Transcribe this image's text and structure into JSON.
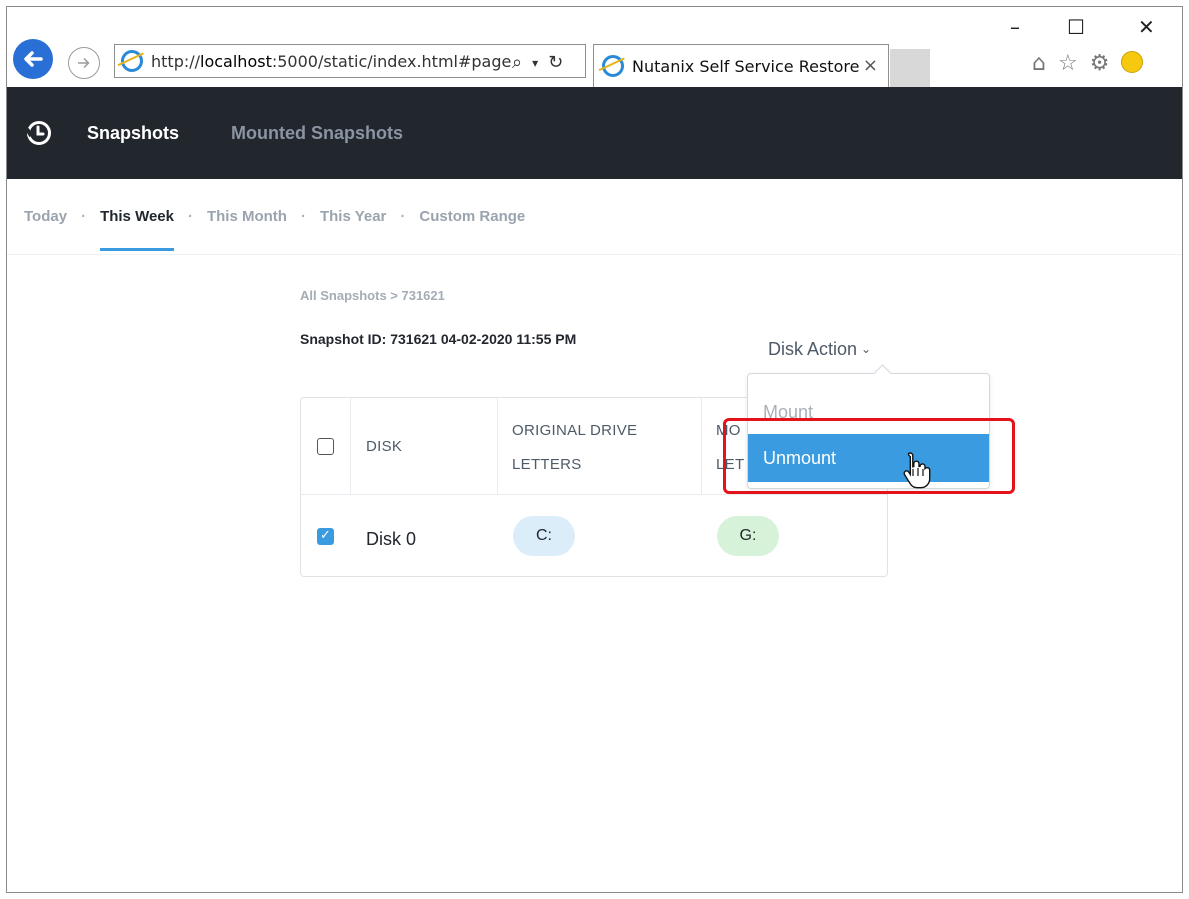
{
  "browser": {
    "url_prefix": "http://",
    "url_host": "localhost",
    "url_rest": ":5000/static/index.html#page",
    "tab_title": "Nutanix Self Service Restore",
    "tab_close": "×",
    "window_minimize": "–",
    "window_maximize": "☐",
    "window_close": "✕"
  },
  "nav": {
    "items": [
      {
        "label": "Snapshots"
      },
      {
        "label": "Mounted Snapshots"
      }
    ]
  },
  "subnav": {
    "items": [
      {
        "label": "Today"
      },
      {
        "label": "This Week"
      },
      {
        "label": "This Month"
      },
      {
        "label": "This Year"
      },
      {
        "label": "Custom Range"
      }
    ],
    "separator": "·"
  },
  "breadcrumb": "All Snapshots > 731621",
  "snapshot_title": "Snapshot ID: 731621 04-02-2020 11:55 PM",
  "disk_action": {
    "label": "Disk Action",
    "options": [
      {
        "label": "Mount"
      },
      {
        "label": "Unmount"
      }
    ]
  },
  "table": {
    "headers": {
      "disk": "DISK",
      "orig_line1": "ORIGINAL DRIVE",
      "orig_line2": "LETTERS",
      "mount_line1": "MO",
      "mount_line2": "LET"
    },
    "rows": [
      {
        "disk": "Disk 0",
        "original": "C:",
        "mounted": "G:"
      }
    ]
  }
}
